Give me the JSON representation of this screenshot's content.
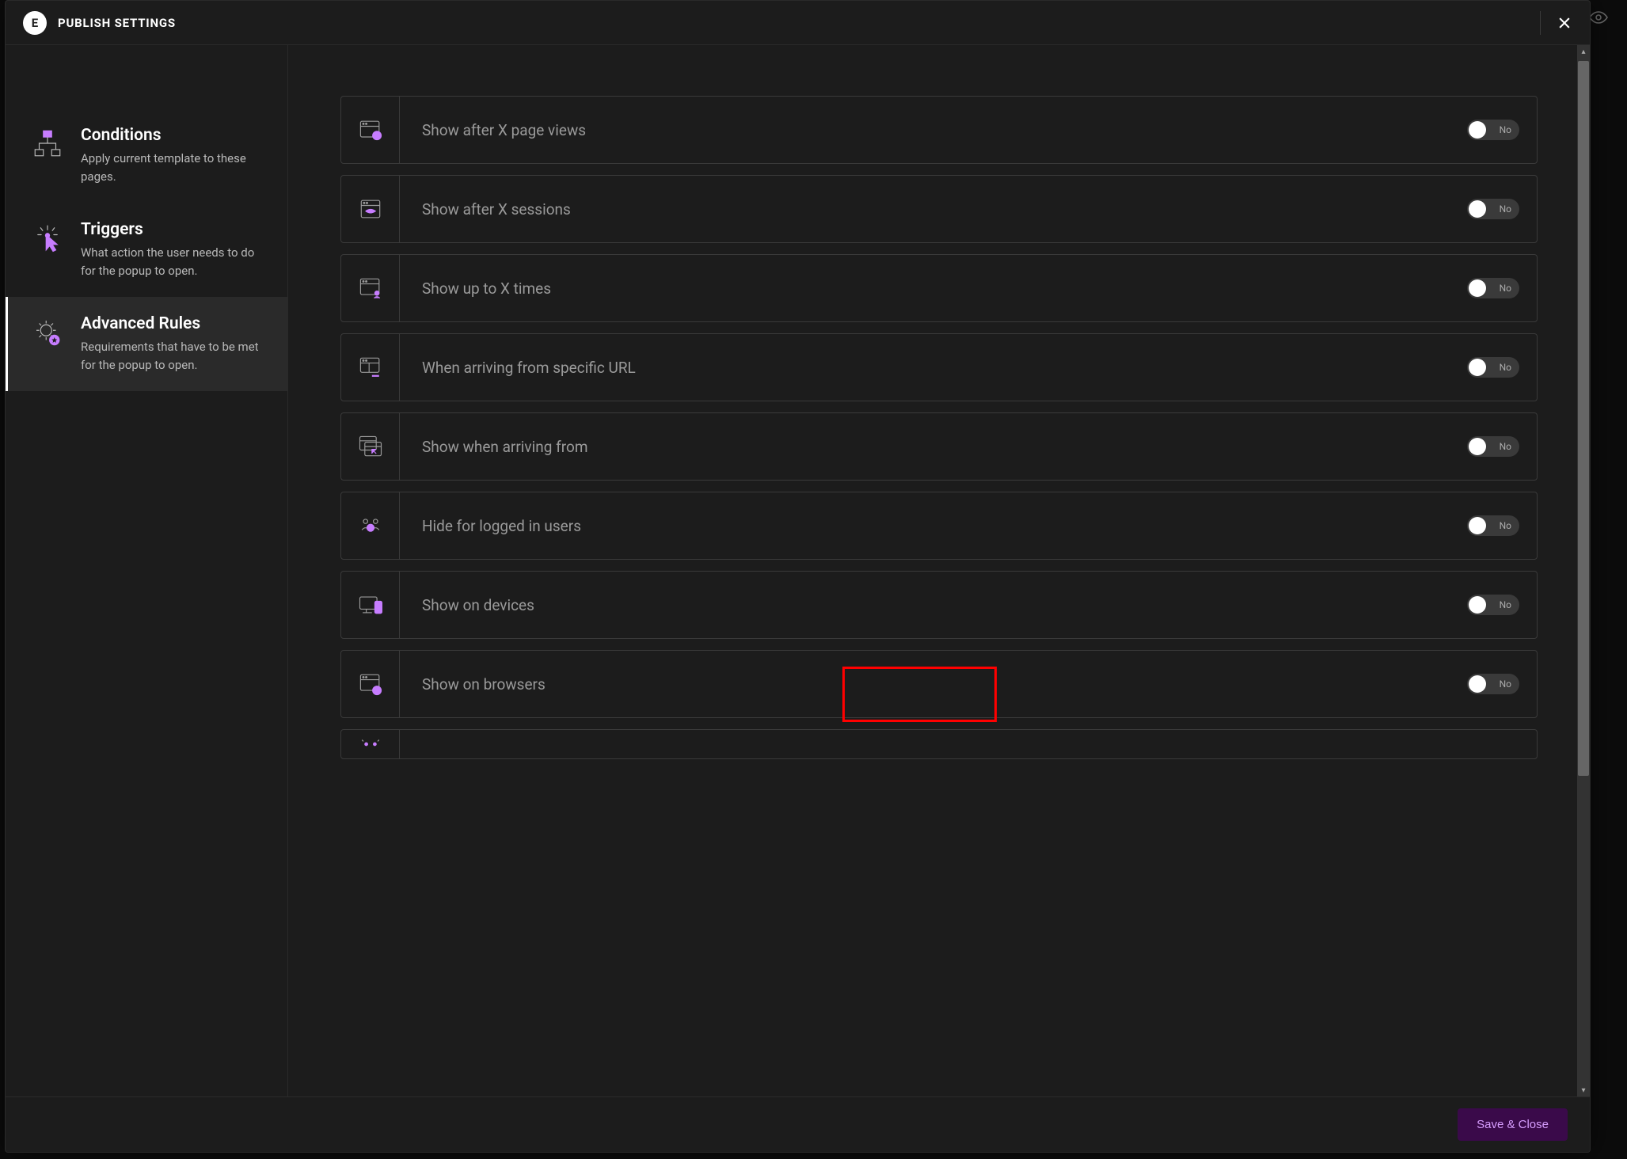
{
  "header": {
    "logo_letter": "E",
    "title": "PUBLISH SETTINGS"
  },
  "sidebar": {
    "items": [
      {
        "title": "Conditions",
        "desc": "Apply current template to these pages.",
        "icon": "sitemap",
        "active": false
      },
      {
        "title": "Triggers",
        "desc": "What action the user needs to do for the popup to open.",
        "icon": "click",
        "active": false
      },
      {
        "title": "Advanced Rules",
        "desc": "Requirements that have to be met for the popup to open.",
        "icon": "gear-star",
        "active": true
      }
    ]
  },
  "rules": [
    {
      "label": "Show after X page views",
      "toggle": "No",
      "icon": "browser-count"
    },
    {
      "label": "Show after X sessions",
      "toggle": "No",
      "icon": "browser-eye"
    },
    {
      "label": "Show up to X times",
      "toggle": "No",
      "icon": "browser-user"
    },
    {
      "label": "When arriving from specific URL",
      "toggle": "No",
      "icon": "browser-link"
    },
    {
      "label": "Show when arriving from",
      "toggle": "No",
      "icon": "browser-arrow"
    },
    {
      "label": "Hide for logged in users",
      "toggle": "No",
      "icon": "users-x"
    },
    {
      "label": "Show on devices",
      "toggle": "No",
      "icon": "devices"
    },
    {
      "label": "Show on browsers",
      "toggle": "No",
      "icon": "browser-check"
    }
  ],
  "footer": {
    "save_label": "Save & Close"
  }
}
